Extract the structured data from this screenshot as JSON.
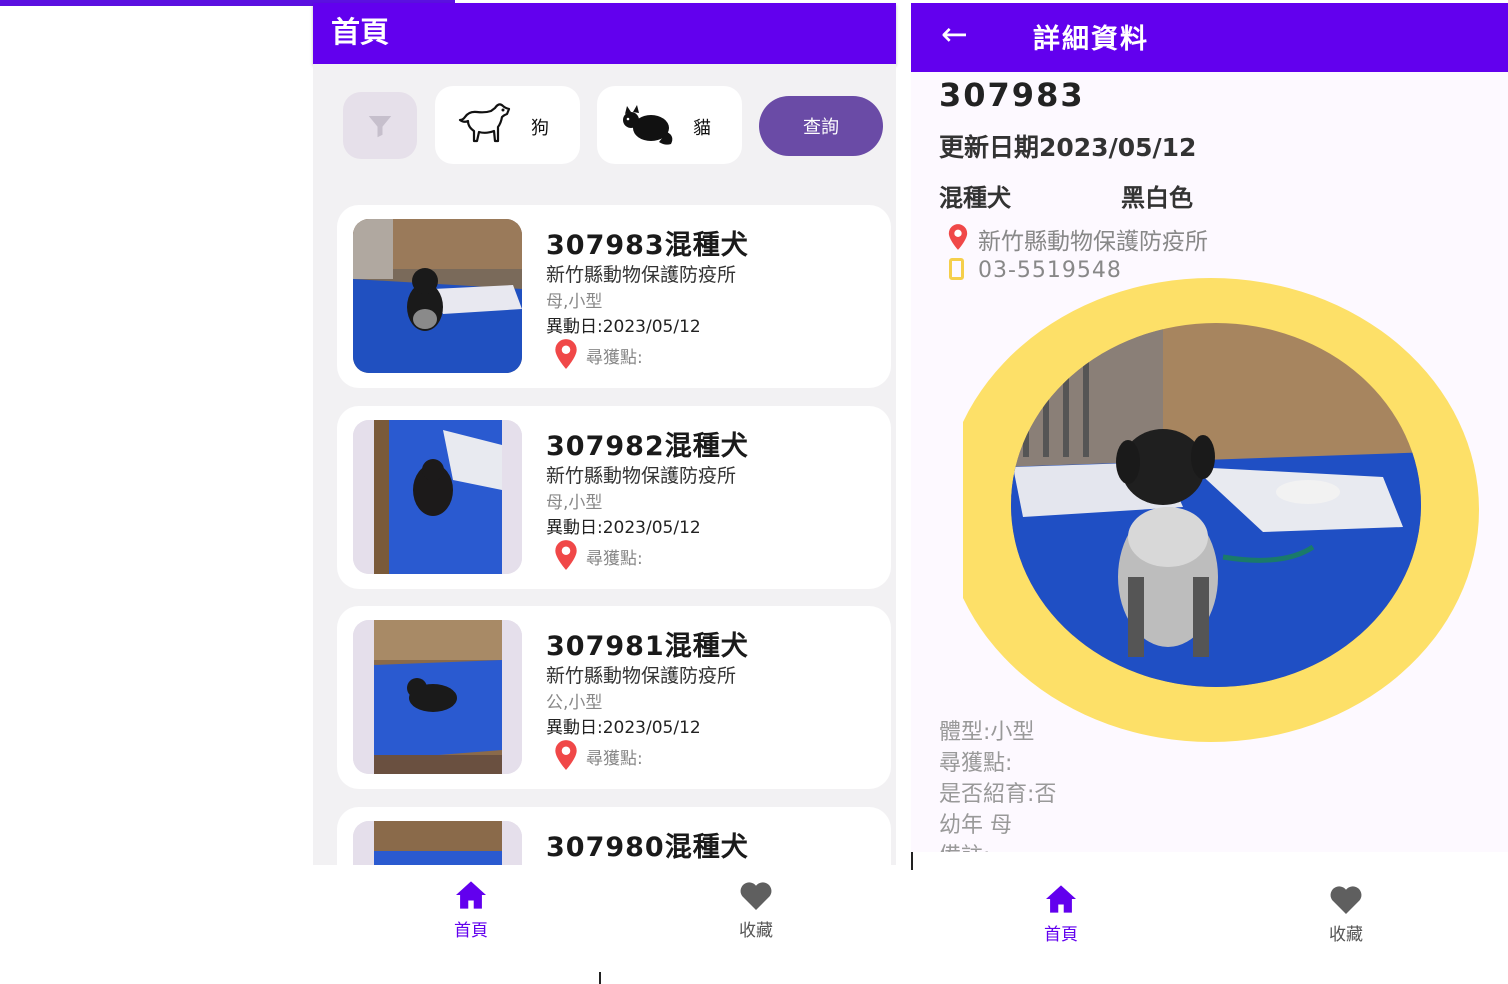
{
  "colors": {
    "primary": "#6200ee",
    "query_button": "#6a4ba6",
    "pin": "#f04848",
    "nav_active": "#6200ee",
    "nav_inactive": "#666666",
    "photo_ring": "#fde068"
  },
  "list_screen": {
    "title": "首頁",
    "filters": {
      "dog_label": "狗",
      "cat_label": "貓",
      "query_label": "查詢"
    },
    "cards": [
      {
        "name": "307983混種犬",
        "org": "新竹縣動物保護防疫所",
        "sex_size": "母,小型",
        "date": "異動日:2023/05/12",
        "found": "尋獲點:"
      },
      {
        "name": "307982混種犬",
        "org": "新竹縣動物保護防疫所",
        "sex_size": "母,小型",
        "date": "異動日:2023/05/12",
        "found": "尋獲點:"
      },
      {
        "name": "307981混種犬",
        "org": "新竹縣動物保護防疫所",
        "sex_size": "公,小型",
        "date": "異動日:2023/05/12",
        "found": "尋獲點:"
      },
      {
        "name": "307980混種犬",
        "org": "",
        "sex_size": "",
        "date": "",
        "found": ""
      }
    ],
    "nav": {
      "home": "首頁",
      "favorites": "收藏"
    }
  },
  "detail_screen": {
    "title": "詳細資料",
    "back_icon": "arrow-left-icon",
    "id": "307983",
    "update_date": "更新日期2023/05/12",
    "breed": "混種犬",
    "color": "黑白色",
    "org": "新竹縣動物保護防疫所",
    "phone": "03-5519548",
    "info": [
      "體型:小型",
      "尋獲點:",
      "是否紹育:否",
      "幼年 母",
      "備註:"
    ],
    "nav": {
      "home": "首頁",
      "favorites": "收藏"
    }
  }
}
